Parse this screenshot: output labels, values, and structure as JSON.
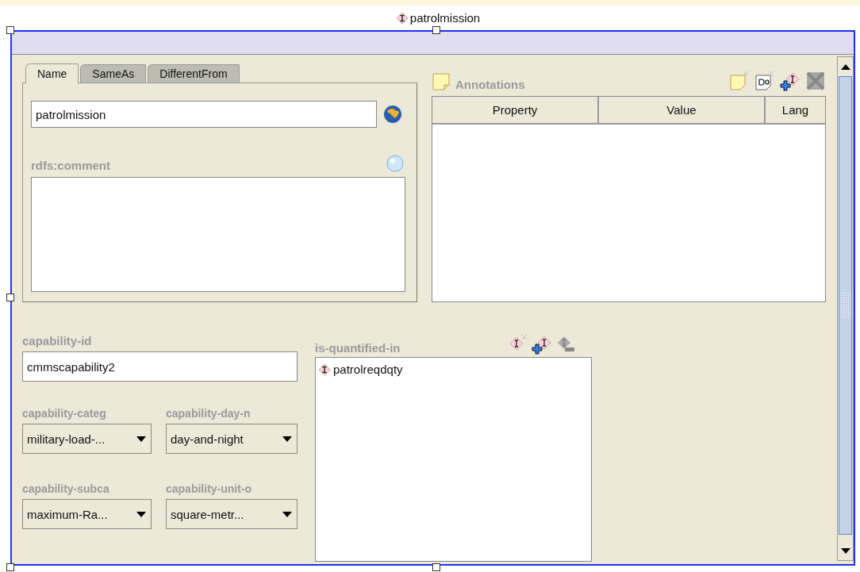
{
  "window": {
    "title": "patrolmission"
  },
  "tabs": [
    {
      "label": "Name",
      "selected": true
    },
    {
      "label": "SameAs",
      "selected": false
    },
    {
      "label": "DifferentFrom",
      "selected": false
    }
  ],
  "name_field": {
    "value": "patrolmission"
  },
  "comment": {
    "label": "rdfs:comment"
  },
  "annotations": {
    "title": "Annotations",
    "columns": [
      "Property",
      "Value",
      "Lang"
    ]
  },
  "capability_id": {
    "label": "capability-id",
    "value": "cmmscapability2"
  },
  "dropdowns": [
    {
      "label": "capability-categ",
      "value": "military-load-..."
    },
    {
      "label": "capability-day-n",
      "value": "day-and-night"
    },
    {
      "label": "capability-subca",
      "value": "maximum-Ra..."
    },
    {
      "label": "capability-unit-o",
      "value": "square-metr..."
    }
  ],
  "is_quantified_in": {
    "label": "is-quantified-in",
    "items": [
      "patrolreqdqty"
    ]
  }
}
